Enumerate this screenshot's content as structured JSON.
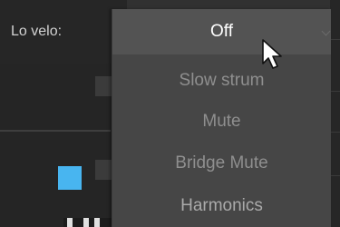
{
  "velocity_field": {
    "label": "Lo velo:"
  },
  "dropdown": {
    "selected": "Off",
    "options": [
      "Slow strum",
      "Mute",
      "Bridge Mute",
      "Harmonics"
    ]
  },
  "colors": {
    "accent_square": "#48b5f0"
  },
  "icons": {
    "pointer": "mouse-pointer-icon"
  }
}
